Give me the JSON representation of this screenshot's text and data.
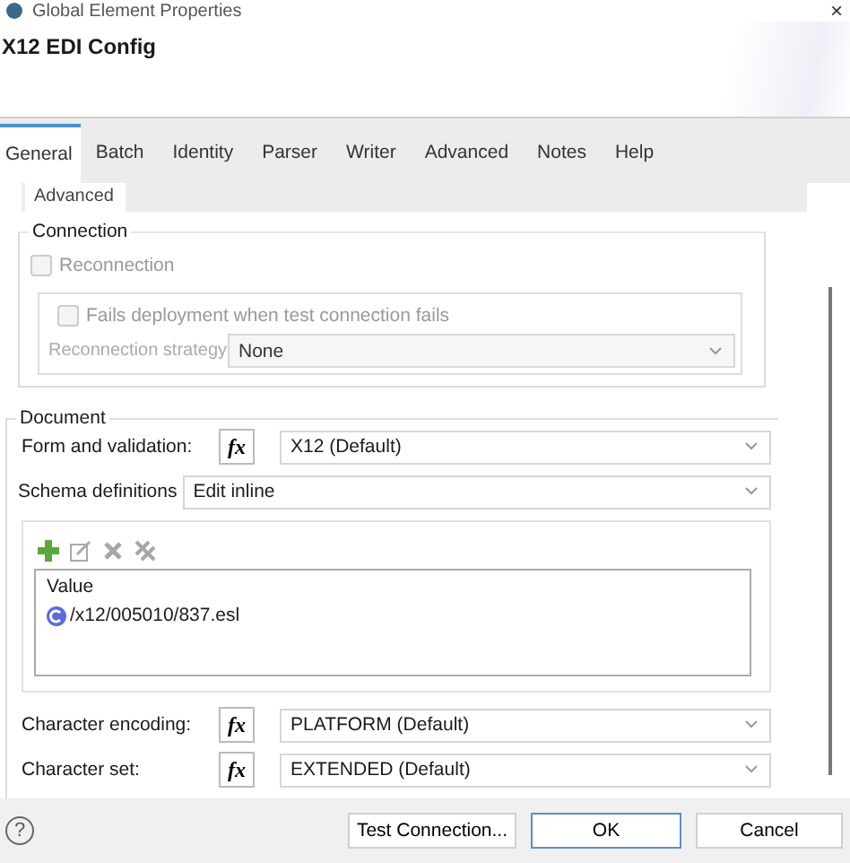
{
  "window": {
    "title": "Global Element Properties",
    "close": "×"
  },
  "header": {
    "title": "X12 EDI Config"
  },
  "tabs": [
    {
      "label": "General",
      "selected": true
    },
    {
      "label": "Batch",
      "selected": false
    },
    {
      "label": "Identity",
      "selected": false
    },
    {
      "label": "Parser",
      "selected": false
    },
    {
      "label": "Writer",
      "selected": false
    },
    {
      "label": "Advanced",
      "selected": false
    },
    {
      "label": "Notes",
      "selected": false
    },
    {
      "label": "Help",
      "selected": false
    }
  ],
  "subtabs": [
    {
      "label": "Advanced",
      "selected": true
    }
  ],
  "connection": {
    "title": "Connection",
    "reconnection": {
      "label": "Reconnection",
      "checked": false,
      "disabled": true
    },
    "fails_deployment": {
      "label": "Fails deployment when test connection fails",
      "checked": false,
      "disabled": true
    },
    "strategy": {
      "label": "Reconnection strategy",
      "value": "None",
      "disabled": true
    }
  },
  "document": {
    "title": "Document",
    "fields_top": [
      {
        "kind": "expression",
        "label": "Form and validation:",
        "fx": "fx",
        "value": "X12 (Default)"
      },
      {
        "kind": "select",
        "label": "Schema definitions",
        "value": "Edit inline"
      }
    ],
    "toolbar": [
      {
        "kind": "add",
        "disabled": false
      },
      {
        "kind": "edit",
        "disabled": true
      },
      {
        "kind": "remove",
        "disabled": true
      },
      {
        "kind": "remove_all",
        "disabled": true
      }
    ],
    "schema_list": {
      "column": "Value",
      "rows": [
        {
          "value": "/x12/005010/837.esl"
        }
      ]
    },
    "fields_bottom": [
      {
        "kind": "expression",
        "label": "Character encoding:",
        "fx": "fx",
        "value": "PLATFORM (Default)"
      },
      {
        "kind": "expression",
        "label": "Character set:",
        "fx": "fx",
        "value": "EXTENDED (Default)"
      }
    ]
  },
  "footer": {
    "help": "?",
    "buttons": [
      {
        "label": "Test Connection...",
        "default": false
      },
      {
        "label": "OK",
        "default": true
      },
      {
        "label": "Cancel",
        "default": false
      }
    ]
  }
}
